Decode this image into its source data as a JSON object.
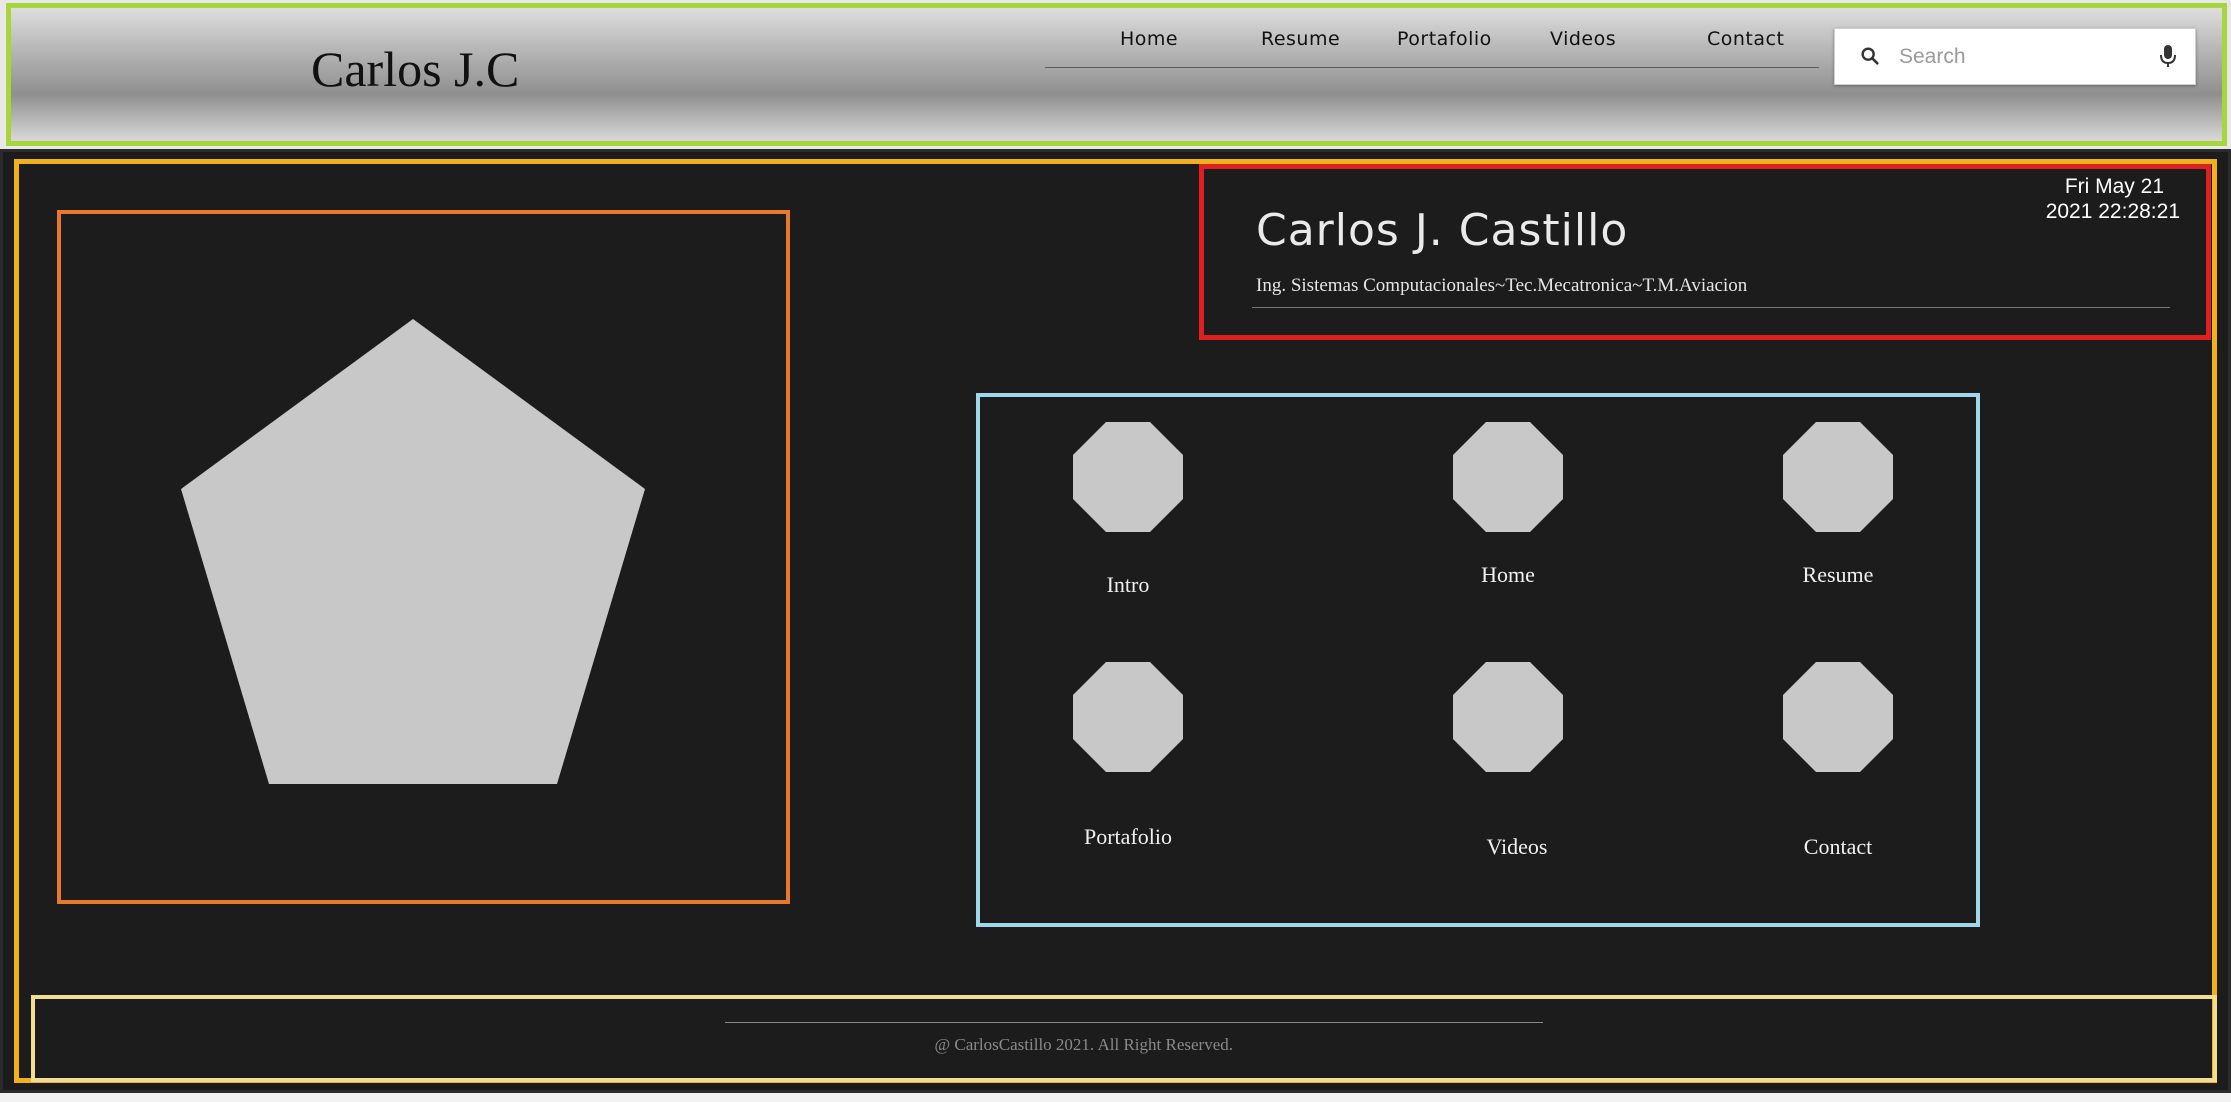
{
  "header": {
    "brand": "Carlos J.C",
    "nav": [
      {
        "label": "Home"
      },
      {
        "label": "Resume"
      },
      {
        "label": "Portafolio"
      },
      {
        "label": "Videos"
      },
      {
        "label": "Contact"
      }
    ],
    "search": {
      "placeholder": "Search",
      "value": "",
      "icon": "search-icon",
      "mic_icon": "mic-icon"
    }
  },
  "hero": {
    "shape": "pentagon",
    "color": "#c8c8c8"
  },
  "title_card": {
    "date_line1": "Fri May 21",
    "date_line2": "2021 22:28:21",
    "name": "Carlos J. Castillo",
    "tagline": "Ing. Sistemas Computacionales~Tec.Mecatronica~T.M.Aviacion"
  },
  "menu": {
    "tile_shape": "octagon",
    "items": [
      {
        "label": "Intro"
      },
      {
        "label": "Home"
      },
      {
        "label": "Resume"
      },
      {
        "label": "Portafolio"
      },
      {
        "label": "Videos"
      },
      {
        "label": "Contact"
      }
    ]
  },
  "footer": {
    "copyright": "@ CarlosCastillo 2021. All Right Reserved."
  },
  "colors": {
    "header_border": "#a6d63c",
    "main_border": "#f0b11c",
    "hero_border": "#e8792c",
    "title_border": "#df2020",
    "menu_border": "#9fd8ec",
    "footer_border": "#f3dc93",
    "background": "#1c1c1c",
    "shape_fill": "#c8c8c8"
  }
}
